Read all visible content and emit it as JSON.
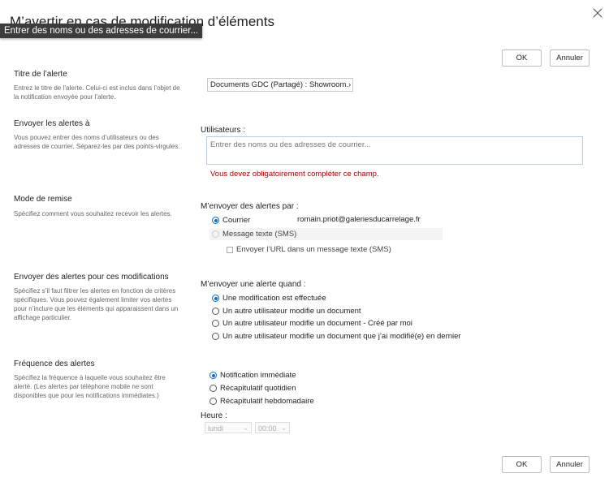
{
  "dialog": {
    "title": "M’avertir en cas de modification d’éléments",
    "tooltip": "Entrer des noms ou des adresses de courrier...",
    "ok_label": "OK",
    "cancel_label": "Annuler"
  },
  "alert_title": {
    "heading": "Titre de l’alerte",
    "description": "Entrez le titre de l’alerte. Celui-ci est inclus dans l’objet de la notification envoyée pour l’alerte.",
    "value": "Documents GDC (Partagé) : Showroom.›"
  },
  "send_to": {
    "heading": "Envoyer les alertes à",
    "description": "Vous pouvez entrer des noms d’utilisateurs ou des adresses de courrier. Séparez-les par des points-virgules.",
    "users_label": "Utilisateurs :",
    "placeholder": "Entrer des noms ou des adresses de courrier...",
    "error": "Vous devez obligatoirement compléter ce champ."
  },
  "delivery": {
    "heading": "Mode de remise",
    "description": "Spécifiez comment vous souhaitez recevoir les alertes.",
    "prompt": "M’envoyer des alertes par :",
    "email_label": "Courrier",
    "email_address": "romain.priot@galeriesducarrelage.fr",
    "sms_label": "Message texte (SMS)",
    "sms_url_label": "Envoyer l’URL dans un message texte (SMS)"
  },
  "changes": {
    "heading": "Envoyer des alertes pour ces modifications",
    "description": "Spécifiez s’il faut filtrer les alertes en fonction de critères spécifiques. Vous pouvez également limiter vos alertes pour n’inclure que les éléments qui apparaissent dans un affichage particulier.",
    "prompt": "M’envoyer une alerte quand :",
    "options": [
      "Une modification est effectuée",
      "Un autre utilisateur modifie un document",
      "Un autre utilisateur modifie un document - Créé par moi",
      "Un autre utilisateur modifie un document que j’ai modifié(e) en dernier"
    ],
    "selected": 0
  },
  "frequency": {
    "heading": "Fréquence des alertes",
    "description": "Spécifiez la fréquence à laquelle vous souhaitez être alerté. (Les alertes par téléphone mobile ne sont disponibles que pour les notifications immédiates.)",
    "options": [
      "Notification immédiate",
      "Récapitulatif quotidien",
      "Récapitulatif hebdomadaire"
    ],
    "selected": 0,
    "time_label": "Heure :",
    "day_value": "lundi",
    "time_value": "00:00"
  },
  "colors": {
    "accent": "#0f6cbd",
    "error": "#a80000"
  },
  "icons": {
    "close": "close-icon",
    "dropdown": "chevron-down-icon"
  }
}
